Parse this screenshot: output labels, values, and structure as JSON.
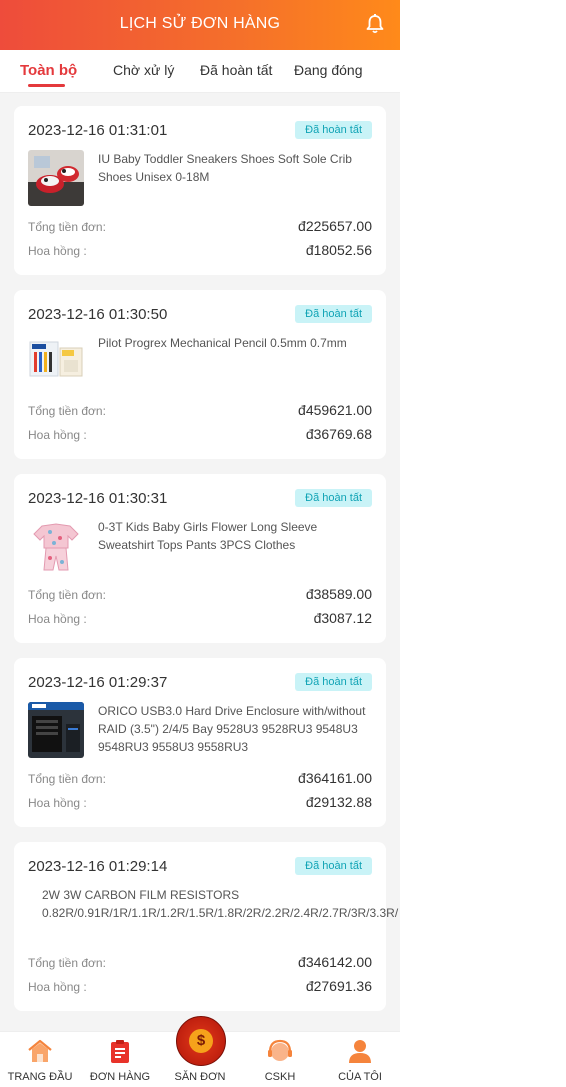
{
  "header": {
    "title": "LỊCH SỬ ĐƠN HÀNG"
  },
  "tabs": [
    {
      "label": "Toàn bộ",
      "active": true
    },
    {
      "label": "Chờ xử lý",
      "active": false
    },
    {
      "label": "Đã hoàn tất",
      "active": false
    },
    {
      "label": "Đang đóng",
      "active": false
    }
  ],
  "labels": {
    "total": "Tổng tiền đơn:",
    "commission": "Hoa hồng :"
  },
  "orders": [
    {
      "date": "2023-12-16 01:31:01",
      "status": "Đã hoàn tất",
      "product": "IU Baby Toddler Sneakers Shoes Soft Sole Crib Shoes Unisex 0-18M",
      "image": "baby-shoes-image",
      "total": "đ225657.00",
      "commission": "đ18052.56"
    },
    {
      "date": "2023-12-16 01:30:50",
      "status": "Đã hoàn tất",
      "product": "Pilot Progrex Mechanical Pencil 0.5mm 0.7mm",
      "image": "pencil-image",
      "total": "đ459621.00",
      "commission": "đ36769.68"
    },
    {
      "date": "2023-12-16 01:30:31",
      "status": "Đã hoàn tất",
      "product": "0-3T Kids Baby Girls Flower Long Sleeve Sweatshirt Tops Pants 3PCS Clothes",
      "image": "kids-clothes-image",
      "total": "đ38589.00",
      "commission": "đ3087.12"
    },
    {
      "date": "2023-12-16 01:29:37",
      "status": "Đã hoàn tất",
      "product": "ORICO USB3.0 Hard Drive Enclosure with/without RAID (3.5\") 2/4/5 Bay 9528U3 9528RU3 9548U3 9548RU3 9558U3 9558RU3",
      "image": "hdd-enclosure-image",
      "total": "đ364161.00",
      "commission": "đ29132.88"
    },
    {
      "date": "2023-12-16 01:29:14",
      "status": "Đã hoàn tất",
      "product": "2W 3W CARBON FILM RESISTORS\n0.82R/0.91R/1R/1.1R/1.2R/1.5R/1.8R/2R/2.2R/2.4R/2.7R/3R/3.3R/",
      "image": null,
      "total": "đ346142.00",
      "commission": "đ27691.36"
    }
  ],
  "bottom_nav": [
    {
      "label": "TRANG ĐẦU",
      "icon": "home-icon"
    },
    {
      "label": "ĐƠN HÀNG",
      "icon": "orders-icon"
    },
    {
      "label": "SĂN ĐƠN",
      "icon": "grab-order-icon",
      "center_symbol": "$"
    },
    {
      "label": "CSKH",
      "icon": "support-icon"
    },
    {
      "label": "CỦA TÔI",
      "icon": "user-icon"
    }
  ]
}
